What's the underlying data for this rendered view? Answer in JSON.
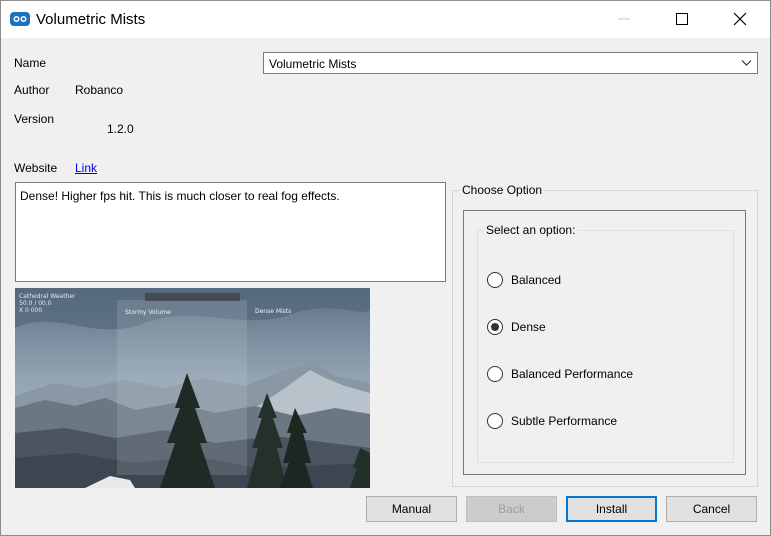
{
  "window": {
    "title": "Volumetric Mists",
    "icon": "app-logo-icon",
    "controls": [
      "minimize-icon",
      "maximize-icon",
      "close-icon"
    ]
  },
  "fields": {
    "name_label": "Name",
    "name_value": "Volumetric Mists",
    "author_label": "Author",
    "author_value": "Robanco",
    "version_label": "Version",
    "version_value": "1.2.0",
    "website_label": "Website",
    "website_link": "Link"
  },
  "description": "Dense! Higher fps hit. This is much closer to real fog effects.",
  "preview": {
    "left_caption": "Stormy Volume",
    "right_caption": "Dense Mists"
  },
  "options": {
    "group_label": "Choose Option",
    "inner_label": "Select an option:",
    "items": [
      {
        "label": "Balanced",
        "checked": false
      },
      {
        "label": "Dense",
        "checked": true
      },
      {
        "label": "Balanced Performance",
        "checked": false
      },
      {
        "label": "Subtle Performance",
        "checked": false
      }
    ]
  },
  "buttons": {
    "manual": "Manual",
    "back": "Back",
    "install": "Install",
    "cancel": "Cancel"
  }
}
